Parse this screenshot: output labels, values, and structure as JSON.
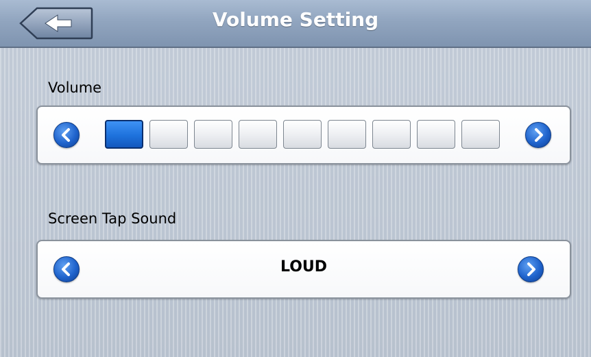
{
  "header": {
    "title": "Volume Setting",
    "back_icon": "back-arrow-icon"
  },
  "volume": {
    "label": "Volume",
    "level": 1,
    "max": 9,
    "active_color": "#1e72dc",
    "prev_icon": "chevron-left-icon",
    "next_icon": "chevron-right-icon"
  },
  "tap_sound": {
    "label": "Screen Tap Sound",
    "value": "LOUD",
    "prev_icon": "chevron-left-icon",
    "next_icon": "chevron-right-icon"
  }
}
